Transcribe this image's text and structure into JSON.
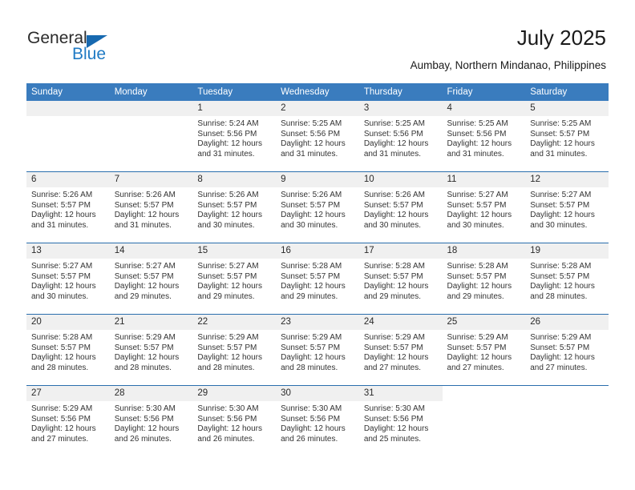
{
  "brand": {
    "name_top": "General",
    "name_bottom": "Blue",
    "accent_color": "#1f7ac4",
    "triangle_color": "#1769b0"
  },
  "header": {
    "title": "July 2025",
    "subtitle": "Aumbay, Northern Mindanao, Philippines",
    "header_bg": "#3a7cbe",
    "separator_color": "#2a6ead",
    "daynum_bg": "#f0f0f0"
  },
  "weekday_headers": [
    "Sunday",
    "Monday",
    "Tuesday",
    "Wednesday",
    "Thursday",
    "Friday",
    "Saturday"
  ],
  "weeks": [
    [
      {
        "day": "",
        "blank": true,
        "sunrise": "",
        "sunset": "",
        "daylight_line1": "",
        "daylight_line2": ""
      },
      {
        "day": "",
        "blank": true,
        "sunrise": "",
        "sunset": "",
        "daylight_line1": "",
        "daylight_line2": ""
      },
      {
        "day": "1",
        "sunrise": "Sunrise: 5:24 AM",
        "sunset": "Sunset: 5:56 PM",
        "daylight_line1": "Daylight: 12 hours",
        "daylight_line2": "and 31 minutes."
      },
      {
        "day": "2",
        "sunrise": "Sunrise: 5:25 AM",
        "sunset": "Sunset: 5:56 PM",
        "daylight_line1": "Daylight: 12 hours",
        "daylight_line2": "and 31 minutes."
      },
      {
        "day": "3",
        "sunrise": "Sunrise: 5:25 AM",
        "sunset": "Sunset: 5:56 PM",
        "daylight_line1": "Daylight: 12 hours",
        "daylight_line2": "and 31 minutes."
      },
      {
        "day": "4",
        "sunrise": "Sunrise: 5:25 AM",
        "sunset": "Sunset: 5:56 PM",
        "daylight_line1": "Daylight: 12 hours",
        "daylight_line2": "and 31 minutes."
      },
      {
        "day": "5",
        "sunrise": "Sunrise: 5:25 AM",
        "sunset": "Sunset: 5:57 PM",
        "daylight_line1": "Daylight: 12 hours",
        "daylight_line2": "and 31 minutes."
      }
    ],
    [
      {
        "day": "6",
        "sunrise": "Sunrise: 5:26 AM",
        "sunset": "Sunset: 5:57 PM",
        "daylight_line1": "Daylight: 12 hours",
        "daylight_line2": "and 31 minutes."
      },
      {
        "day": "7",
        "sunrise": "Sunrise: 5:26 AM",
        "sunset": "Sunset: 5:57 PM",
        "daylight_line1": "Daylight: 12 hours",
        "daylight_line2": "and 31 minutes."
      },
      {
        "day": "8",
        "sunrise": "Sunrise: 5:26 AM",
        "sunset": "Sunset: 5:57 PM",
        "daylight_line1": "Daylight: 12 hours",
        "daylight_line2": "and 30 minutes."
      },
      {
        "day": "9",
        "sunrise": "Sunrise: 5:26 AM",
        "sunset": "Sunset: 5:57 PM",
        "daylight_line1": "Daylight: 12 hours",
        "daylight_line2": "and 30 minutes."
      },
      {
        "day": "10",
        "sunrise": "Sunrise: 5:26 AM",
        "sunset": "Sunset: 5:57 PM",
        "daylight_line1": "Daylight: 12 hours",
        "daylight_line2": "and 30 minutes."
      },
      {
        "day": "11",
        "sunrise": "Sunrise: 5:27 AM",
        "sunset": "Sunset: 5:57 PM",
        "daylight_line1": "Daylight: 12 hours",
        "daylight_line2": "and 30 minutes."
      },
      {
        "day": "12",
        "sunrise": "Sunrise: 5:27 AM",
        "sunset": "Sunset: 5:57 PM",
        "daylight_line1": "Daylight: 12 hours",
        "daylight_line2": "and 30 minutes."
      }
    ],
    [
      {
        "day": "13",
        "sunrise": "Sunrise: 5:27 AM",
        "sunset": "Sunset: 5:57 PM",
        "daylight_line1": "Daylight: 12 hours",
        "daylight_line2": "and 30 minutes."
      },
      {
        "day": "14",
        "sunrise": "Sunrise: 5:27 AM",
        "sunset": "Sunset: 5:57 PM",
        "daylight_line1": "Daylight: 12 hours",
        "daylight_line2": "and 29 minutes."
      },
      {
        "day": "15",
        "sunrise": "Sunrise: 5:27 AM",
        "sunset": "Sunset: 5:57 PM",
        "daylight_line1": "Daylight: 12 hours",
        "daylight_line2": "and 29 minutes."
      },
      {
        "day": "16",
        "sunrise": "Sunrise: 5:28 AM",
        "sunset": "Sunset: 5:57 PM",
        "daylight_line1": "Daylight: 12 hours",
        "daylight_line2": "and 29 minutes."
      },
      {
        "day": "17",
        "sunrise": "Sunrise: 5:28 AM",
        "sunset": "Sunset: 5:57 PM",
        "daylight_line1": "Daylight: 12 hours",
        "daylight_line2": "and 29 minutes."
      },
      {
        "day": "18",
        "sunrise": "Sunrise: 5:28 AM",
        "sunset": "Sunset: 5:57 PM",
        "daylight_line1": "Daylight: 12 hours",
        "daylight_line2": "and 29 minutes."
      },
      {
        "day": "19",
        "sunrise": "Sunrise: 5:28 AM",
        "sunset": "Sunset: 5:57 PM",
        "daylight_line1": "Daylight: 12 hours",
        "daylight_line2": "and 28 minutes."
      }
    ],
    [
      {
        "day": "20",
        "sunrise": "Sunrise: 5:28 AM",
        "sunset": "Sunset: 5:57 PM",
        "daylight_line1": "Daylight: 12 hours",
        "daylight_line2": "and 28 minutes."
      },
      {
        "day": "21",
        "sunrise": "Sunrise: 5:29 AM",
        "sunset": "Sunset: 5:57 PM",
        "daylight_line1": "Daylight: 12 hours",
        "daylight_line2": "and 28 minutes."
      },
      {
        "day": "22",
        "sunrise": "Sunrise: 5:29 AM",
        "sunset": "Sunset: 5:57 PM",
        "daylight_line1": "Daylight: 12 hours",
        "daylight_line2": "and 28 minutes."
      },
      {
        "day": "23",
        "sunrise": "Sunrise: 5:29 AM",
        "sunset": "Sunset: 5:57 PM",
        "daylight_line1": "Daylight: 12 hours",
        "daylight_line2": "and 28 minutes."
      },
      {
        "day": "24",
        "sunrise": "Sunrise: 5:29 AM",
        "sunset": "Sunset: 5:57 PM",
        "daylight_line1": "Daylight: 12 hours",
        "daylight_line2": "and 27 minutes."
      },
      {
        "day": "25",
        "sunrise": "Sunrise: 5:29 AM",
        "sunset": "Sunset: 5:57 PM",
        "daylight_line1": "Daylight: 12 hours",
        "daylight_line2": "and 27 minutes."
      },
      {
        "day": "26",
        "sunrise": "Sunrise: 5:29 AM",
        "sunset": "Sunset: 5:57 PM",
        "daylight_line1": "Daylight: 12 hours",
        "daylight_line2": "and 27 minutes."
      }
    ],
    [
      {
        "day": "27",
        "sunrise": "Sunrise: 5:29 AM",
        "sunset": "Sunset: 5:56 PM",
        "daylight_line1": "Daylight: 12 hours",
        "daylight_line2": "and 27 minutes."
      },
      {
        "day": "28",
        "sunrise": "Sunrise: 5:30 AM",
        "sunset": "Sunset: 5:56 PM",
        "daylight_line1": "Daylight: 12 hours",
        "daylight_line2": "and 26 minutes."
      },
      {
        "day": "29",
        "sunrise": "Sunrise: 5:30 AM",
        "sunset": "Sunset: 5:56 PM",
        "daylight_line1": "Daylight: 12 hours",
        "daylight_line2": "and 26 minutes."
      },
      {
        "day": "30",
        "sunrise": "Sunrise: 5:30 AM",
        "sunset": "Sunset: 5:56 PM",
        "daylight_line1": "Daylight: 12 hours",
        "daylight_line2": "and 26 minutes."
      },
      {
        "day": "31",
        "sunrise": "Sunrise: 5:30 AM",
        "sunset": "Sunset: 5:56 PM",
        "daylight_line1": "Daylight: 12 hours",
        "daylight_line2": "and 25 minutes."
      },
      {
        "day": "",
        "empty": true,
        "sunrise": "",
        "sunset": "",
        "daylight_line1": "",
        "daylight_line2": ""
      },
      {
        "day": "",
        "empty": true,
        "sunrise": "",
        "sunset": "",
        "daylight_line1": "",
        "daylight_line2": ""
      }
    ]
  ]
}
